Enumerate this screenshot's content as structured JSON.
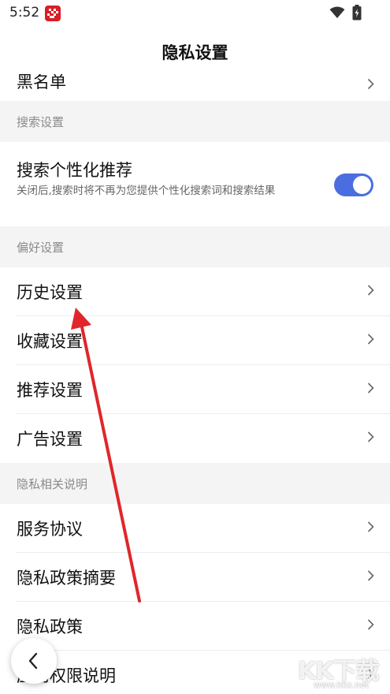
{
  "status_bar": {
    "time": "5:52",
    "app_badge_icon": "app-logo-icon",
    "wifi_icon": "wifi-icon",
    "battery_icon": "battery-charging-icon"
  },
  "header": {
    "title": "隐私设置"
  },
  "rows": {
    "blacklist": "黑名单",
    "search_section": "搜索设置",
    "search_personalized": {
      "title": "搜索个性化推荐",
      "description": "关闭后,搜索时将不再为您提供个性化搜索词和搜索结果",
      "enabled": true
    },
    "preference_section": "偏好设置",
    "history": "历史设置",
    "favorites": "收藏设置",
    "recommend": "推荐设置",
    "ads": "广告设置",
    "privacy_section": "隐私相关说明",
    "service_agreement": "服务协议",
    "privacy_summary": "隐私政策摘要",
    "privacy_policy": "隐私政策",
    "permissions": "应用权限说明"
  },
  "overlay": {
    "watermark_text": "KK下载",
    "watermark_url": "www.kkx.net"
  },
  "colors": {
    "toggle_on": "#4a6ee0",
    "annotation_arrow": "#e0262b",
    "section_bg": "#f4f4f4"
  }
}
